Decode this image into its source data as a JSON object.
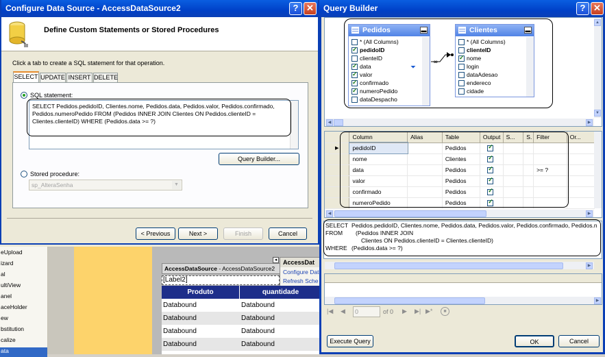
{
  "left": {
    "toolbox_items": [
      "eUpload",
      "izard",
      "al",
      "ultiView",
      "anel",
      "aceHolder",
      "ew",
      "bstitution",
      "calize",
      "ata"
    ],
    "ds_bar": {
      "bold": "AccessDataSource",
      "rest": " - AccessDataSource2"
    },
    "smart": {
      "title": "AccessDat",
      "items": [
        "Configure Dat",
        "Refresh Sche"
      ]
    },
    "label": "[Label2]",
    "table_headers": [
      "Produto",
      "quantidade"
    ],
    "cell": "Databound"
  },
  "config": {
    "title": "Configure Data Source - AccessDataSource2",
    "header": "Define Custom Statements or Stored Procedures",
    "instruction": "Click a tab to create a SQL statement for that operation.",
    "tabs": [
      "SELECT",
      "UPDATE",
      "INSERT",
      "DELETE"
    ],
    "sql_label": "SQL statement:",
    "sql_text": "SELECT Pedidos.pedidoID, Clientes.nome, Pedidos.data, Pedidos.valor, Pedidos.confirmado, Pedidos.numeroPedido FROM (Pedidos INNER JOIN Clientes ON Pedidos.clienteID = Clientes.clienteID) WHERE (Pedidos.data >= ?)",
    "query_builder": "Query Builder...",
    "sp_label": "Stored procedure:",
    "sp_value": "sp_AlteraSenha",
    "buttons": {
      "prev": "< Previous",
      "next": "Next >",
      "finish": "Finish",
      "cancel": "Cancel"
    }
  },
  "qb": {
    "title": "Query Builder",
    "pedidos": {
      "name": "Pedidos",
      "columns": [
        {
          "n": "* (All Columns)",
          "c": false
        },
        {
          "n": "pedidoID",
          "c": true,
          "b": true
        },
        {
          "n": "clienteID",
          "c": false
        },
        {
          "n": "data",
          "c": true
        },
        {
          "n": "valor",
          "c": true
        },
        {
          "n": "confirmado",
          "c": true
        },
        {
          "n": "numeroPedido",
          "c": true
        },
        {
          "n": "dataDespacho",
          "c": false
        }
      ]
    },
    "clientes": {
      "name": "Clientes",
      "columns": [
        {
          "n": "* (All Columns)",
          "c": false
        },
        {
          "n": "clienteID",
          "c": false,
          "b": true
        },
        {
          "n": "nome",
          "c": true
        },
        {
          "n": "login",
          "c": false
        },
        {
          "n": "dataAdesao",
          "c": false
        },
        {
          "n": "endereco",
          "c": false
        },
        {
          "n": "cidade",
          "c": false
        }
      ]
    },
    "grid_headers": [
      "Column",
      "Alias",
      "Table",
      "Output",
      "S...",
      "S.",
      "Filter",
      "Or..."
    ],
    "grid_rows": [
      {
        "col": "pedidoID",
        "table": "Pedidos",
        "filter": ""
      },
      {
        "col": "nome",
        "table": "Clientes",
        "filter": ""
      },
      {
        "col": "data",
        "table": "Pedidos",
        "filter": ">= ?"
      },
      {
        "col": "valor",
        "table": "Pedidos",
        "filter": ""
      },
      {
        "col": "confirmado",
        "table": "Pedidos",
        "filter": ""
      },
      {
        "col": "numeroPedido",
        "table": "Pedidos",
        "filter": ""
      }
    ],
    "sql": [
      {
        "kw": "SELECT",
        "txt": "Pedidos.pedidoID, Clientes.nome, Pedidos.data, Pedidos.valor, Pedidos.confirmado, Pedidos.n"
      },
      {
        "kw": "FROM",
        "txt": "(Pedidos INNER JOIN"
      },
      {
        "kw": "",
        "txt": "Clientes ON Pedidos.clienteID = Clientes.clienteID)"
      },
      {
        "kw": "WHERE",
        "txt": "(Pedidos.data >= ?)"
      }
    ],
    "nav": {
      "pos": "0",
      "of": "of 0"
    },
    "buttons": {
      "execute": "Execute Query",
      "ok": "OK",
      "cancel": "Cancel"
    }
  }
}
